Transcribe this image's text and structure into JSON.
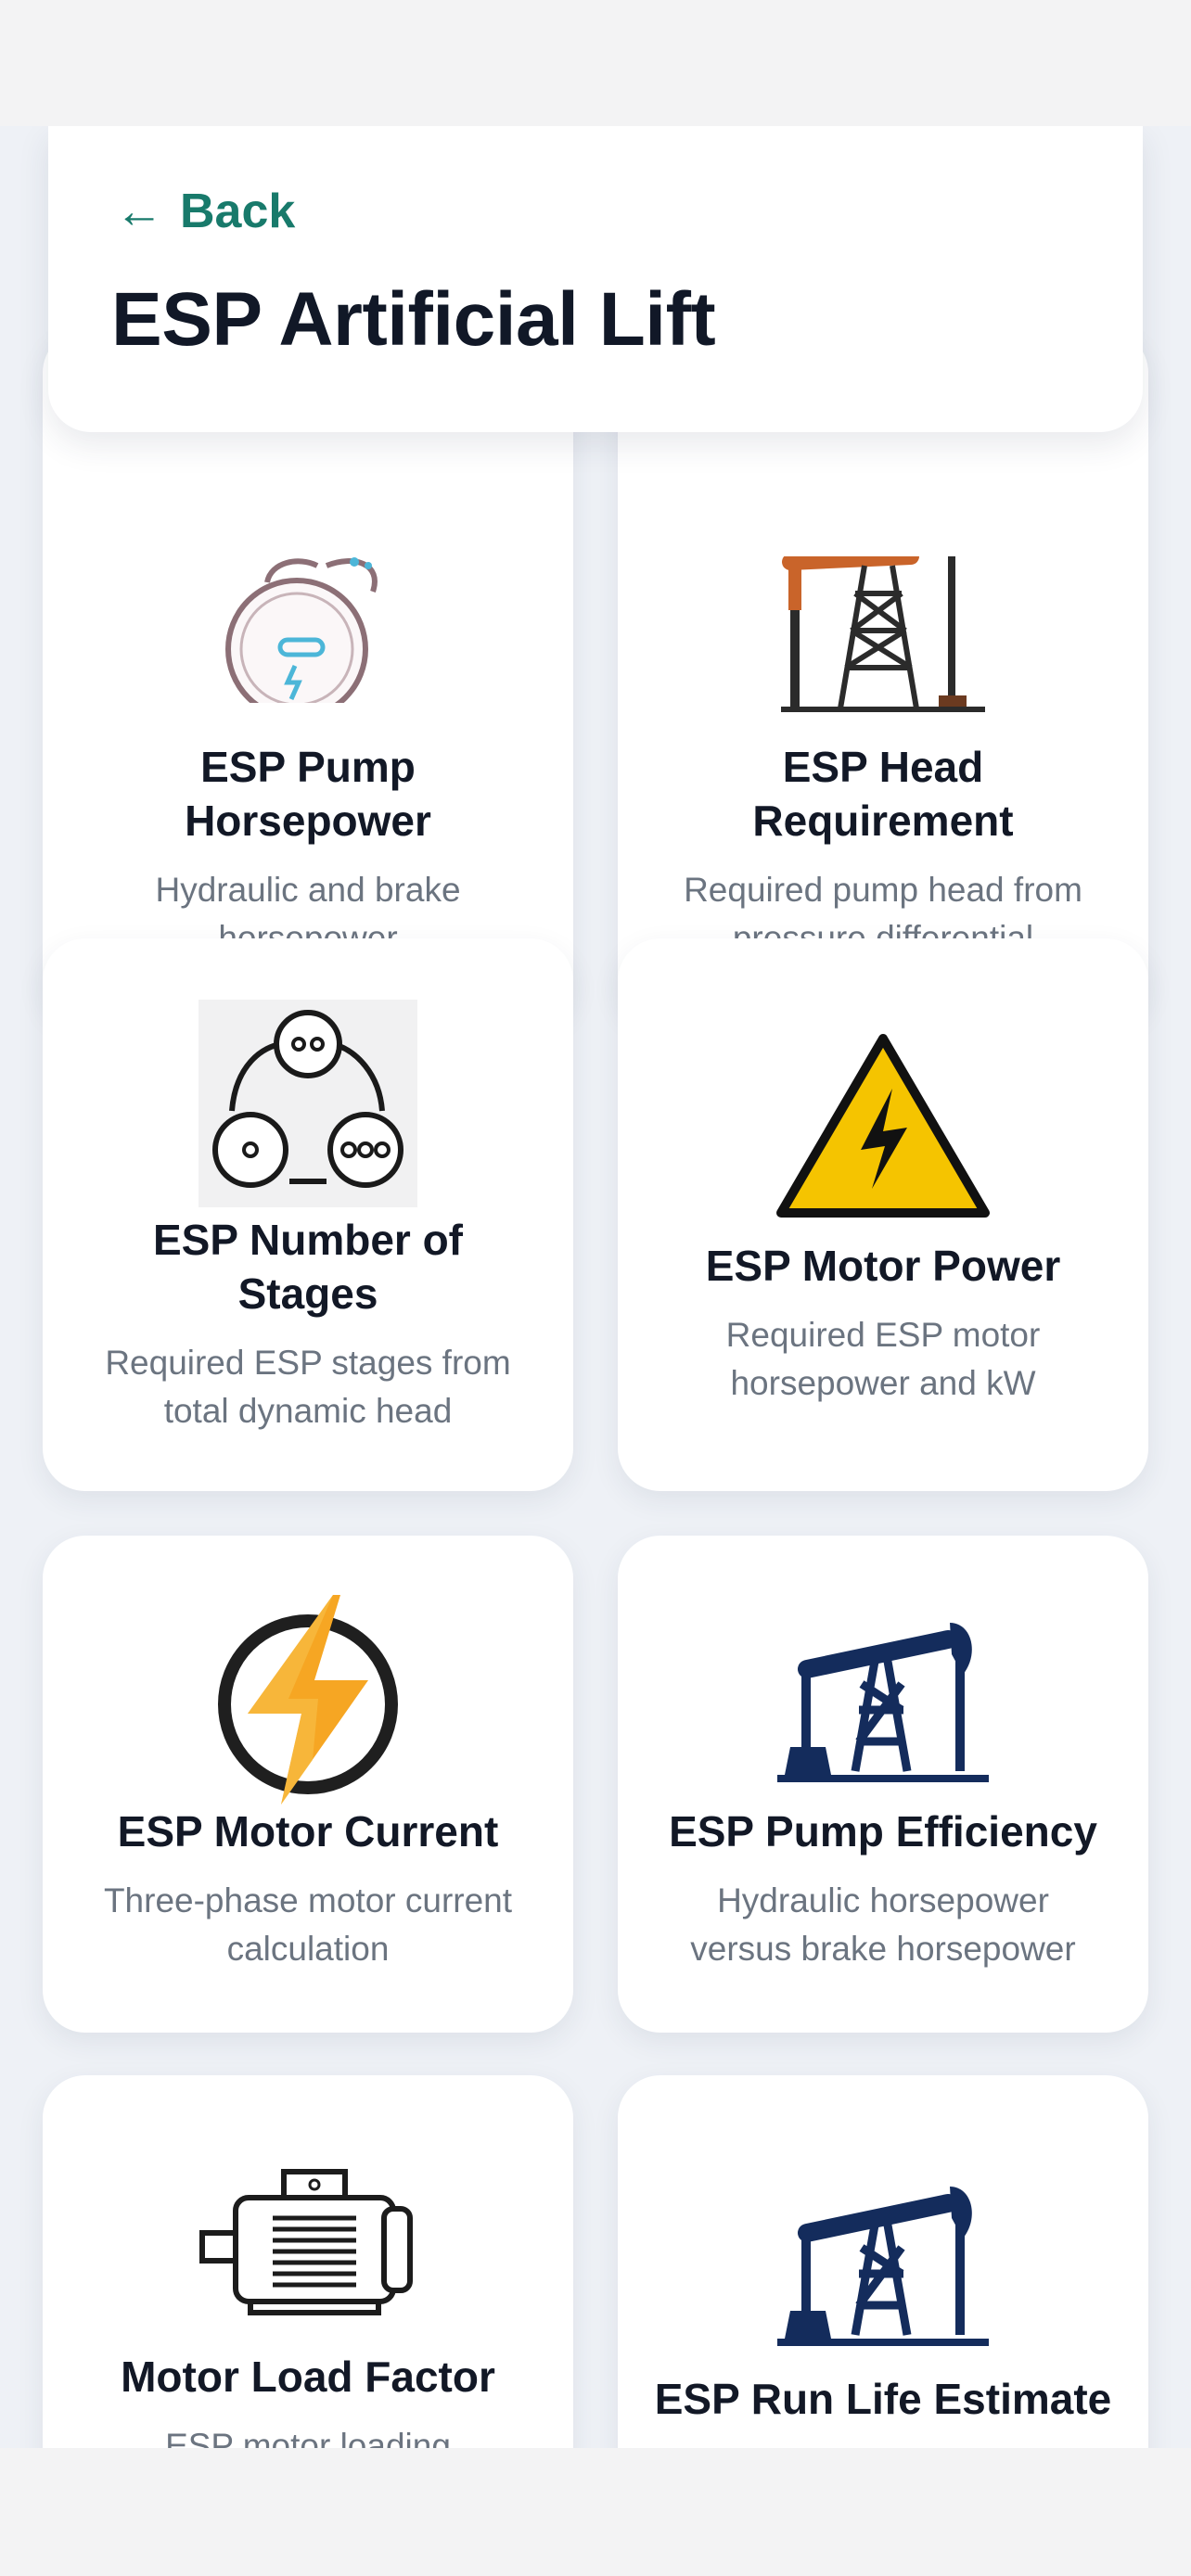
{
  "header": {
    "back_label": "Back",
    "back_arrow": "←",
    "title": "ESP Artificial Lift"
  },
  "cards": [
    {
      "title_line1": "ESP Pump",
      "title_line2": "Horsepower",
      "desc_line1": "Hydraulic and brake",
      "desc_line2": "horsepower",
      "icon": "pump-gauge-icon"
    },
    {
      "title_line1": "ESP Head",
      "title_line2": "Requirement",
      "desc_line1": "Required pump head from",
      "desc_line2": "pressure differential",
      "icon": "pumpjack-derrick-icon"
    },
    {
      "title_line1": "ESP Number of",
      "title_line2": "Stages",
      "desc_line1": "Required ESP stages from",
      "desc_line2": "total dynamic head",
      "icon": "stages-circles-icon"
    },
    {
      "title_line1": "ESP Motor Power",
      "title_line2": "",
      "desc_line1": "Required ESP motor",
      "desc_line2": "horsepower and kW",
      "icon": "high-voltage-warning-icon"
    },
    {
      "title_line1": "ESP Motor Current",
      "title_line2": "",
      "desc_line1": "Three-phase motor current",
      "desc_line2": "calculation",
      "icon": "lightning-bolt-icon"
    },
    {
      "title_line1": "ESP Pump Efficiency",
      "title_line2": "",
      "desc_line1": "Hydraulic horsepower",
      "desc_line2": "versus brake horsepower",
      "icon": "pumpjack-icon"
    },
    {
      "title_line1": "Motor Load Factor",
      "title_line2": "",
      "desc_line1": "ESP motor loading",
      "desc_line2": "",
      "icon": "electric-motor-icon"
    },
    {
      "title_line1": "ESP Run Life Estimate",
      "title_line2": "",
      "desc_line1": "",
      "desc_line2": "",
      "icon": "pumpjack-icon"
    }
  ],
  "colors": {
    "accent": "#187a6b",
    "title": "#121826",
    "desc": "#6b7480",
    "navy": "#142c5c",
    "warning_yellow": "#f5c400",
    "bolt_orange": "#f6a623"
  }
}
